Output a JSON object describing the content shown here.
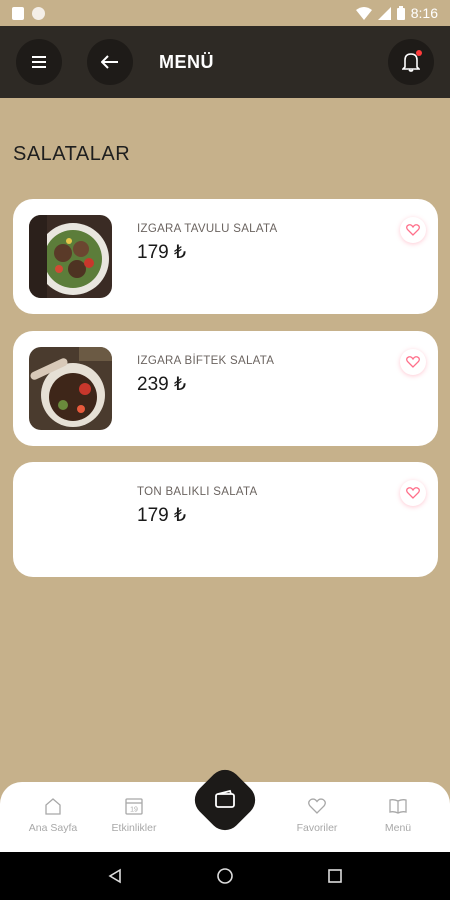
{
  "status_bar": {
    "time": "8:16"
  },
  "app_bar": {
    "title": "MENÜ"
  },
  "section": {
    "title": "SALATALAR"
  },
  "items": [
    {
      "name": "IZGARA TAVULU SALATA",
      "price": "179 ₺"
    },
    {
      "name": "IZGARA BİFTEK SALATA",
      "price": "239 ₺"
    },
    {
      "name": "TON BALIKLI SALATA",
      "price": "179 ₺"
    }
  ],
  "bottom_nav": [
    {
      "label": "Ana Sayfa",
      "icon": "home-icon"
    },
    {
      "label": "Etkinlikler",
      "icon": "calendar-icon"
    },
    {
      "label": "Favoriler",
      "icon": "heart-icon"
    },
    {
      "label": "Menü",
      "icon": "book-icon"
    }
  ],
  "calendar_day": "19",
  "colors": {
    "background": "#c6b18b",
    "app_bar": "#2e2a25",
    "card": "#ffffff",
    "accent": "#ff6f8a"
  }
}
